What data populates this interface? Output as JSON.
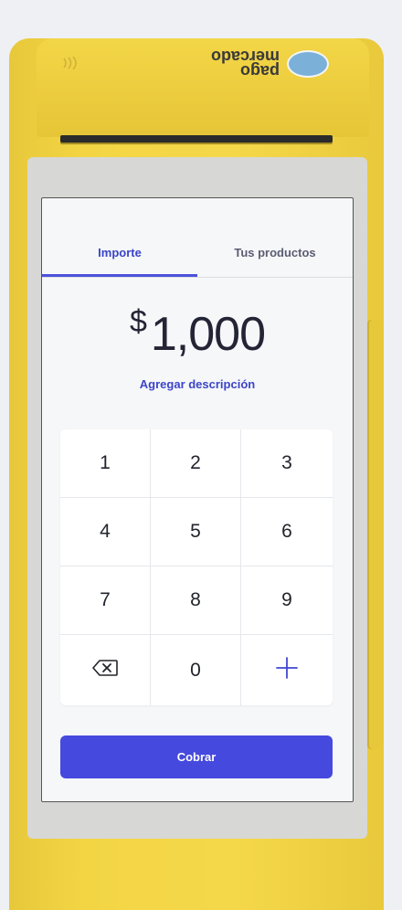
{
  "device": {
    "brand_line1": "mercado",
    "brand_line2": "pago",
    "nfc_label": "))) "
  },
  "tabs": [
    {
      "label": "Importe",
      "active": true
    },
    {
      "label": "Tus productos",
      "active": false
    }
  ],
  "amount": {
    "currency": "$",
    "value": "1,000"
  },
  "description_link": "Agregar descripción",
  "keypad": {
    "rows": [
      [
        "1",
        "2",
        "3"
      ],
      [
        "4",
        "5",
        "6"
      ],
      [
        "7",
        "8",
        "9"
      ],
      [
        "backspace-icon",
        "0",
        "plus-icon"
      ]
    ],
    "k1": "1",
    "k2": "2",
    "k3": "3",
    "k4": "4",
    "k5": "5",
    "k6": "6",
    "k7": "7",
    "k8": "8",
    "k9": "9",
    "k0": "0",
    "plus": "+"
  },
  "charge_button": "Cobrar",
  "colors": {
    "accent": "#4549dd",
    "device_yellow": "#f3d544"
  }
}
